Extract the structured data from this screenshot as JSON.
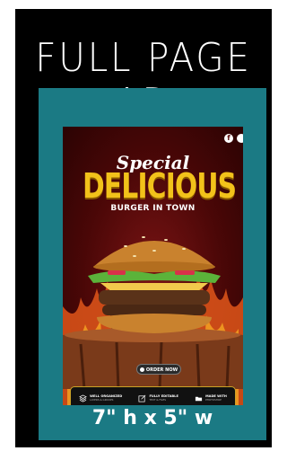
{
  "headline": "FULL PAGE AD",
  "size_label": "7\" h x 5\" w",
  "poster": {
    "special": "Special",
    "title": "DELICIOUS",
    "subtitle": "BURGER IN TOWN",
    "social_icon": "f",
    "order_button": "ORDER NOW",
    "features": [
      {
        "icon": "layers-icon",
        "title": "WELL ORGANIZED",
        "sub": "LAYERS & GROUPS"
      },
      {
        "icon": "edit-icon",
        "title": "FULLY EDITABLE",
        "sub": "TEXT & FILES"
      },
      {
        "icon": "folder-icon",
        "title": "MADE WITH",
        "sub": "PHOTOSHOP"
      }
    ]
  },
  "colors": {
    "frame": "#000000",
    "teal_panel": "#1b7a84",
    "title_gold": "#f2c21a",
    "poster_red": "#5a0a0a"
  }
}
